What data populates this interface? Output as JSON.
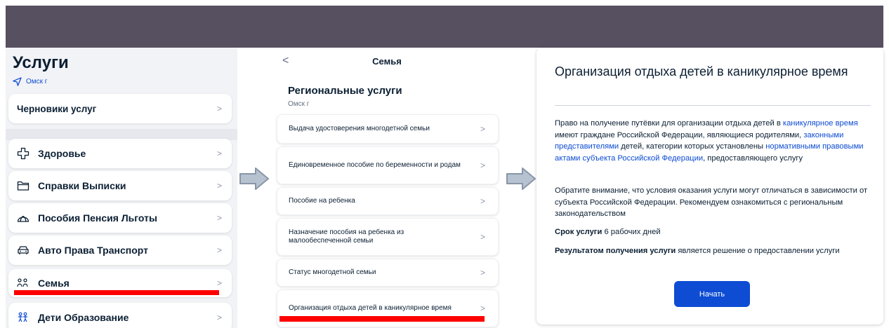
{
  "panel1": {
    "title": "Услуги",
    "location": "Омск г",
    "drafts": "Черновики услуг",
    "categories": [
      {
        "label": "Здоровье"
      },
      {
        "label": "Справки Выписки"
      },
      {
        "label": "Пособия Пенсия Льготы"
      },
      {
        "label": "Авто Права Транспорт"
      },
      {
        "label": "Семья"
      },
      {
        "label": "Дети Образование"
      }
    ]
  },
  "panel2": {
    "header": "Семья",
    "section_title": "Региональные услуги",
    "location": "Омск г",
    "items": [
      {
        "label": "Выдача удостоверения многодетной семьи"
      },
      {
        "label": "Единовременное пособие по беременности и родам"
      },
      {
        "label": "Пособие на ребенка"
      },
      {
        "label": "Назначение пособия на ребенка из малообеспеченной семьи"
      },
      {
        "label": "Статус многодетной семьи"
      },
      {
        "label": "Организация отдыха детей в каникулярное время"
      }
    ]
  },
  "panel3": {
    "title": "Организация отдыха детей в каникулярное время",
    "p1": {
      "t1": "Право на получение путёвки для организации отдыха детей в ",
      "l1": "каникулярное время",
      "t2": " имеют граждане Российской Федерации, являющиеся родителями, ",
      "l2": "законными представителями",
      "t3": " детей, категории которых установлены ",
      "l3": "нормативными правовыми актами субъекта Российской Федерации",
      "t4": ", предоставляющего услугу"
    },
    "p2": "Обратите внимание, что условия оказания услуги могут отличаться в зависимости от субъекта Российской Федерации. Рекомендуем ознакомиться с региональным законодательством",
    "term_label": "Срок услуги",
    "term_value": " 6 рабочих дней",
    "result_label": "Результатом получения услуги",
    "result_text": " является решение о предоставлении услуги",
    "start_button": "Начать"
  },
  "colors": {
    "accent": "#0d4cd3",
    "highlight": "#ff0000",
    "top_bar": "#575060",
    "arrow_fill": "#b7c2d0",
    "arrow_stroke": "#8896a8"
  },
  "icons": [
    "location-arrow-icon",
    "chevron-right-icon",
    "health-cross-icon",
    "folder-icon",
    "umbrella-icon",
    "car-icon",
    "family-icon",
    "children-icon",
    "back-chevron-icon",
    "arrow-right-icon"
  ]
}
